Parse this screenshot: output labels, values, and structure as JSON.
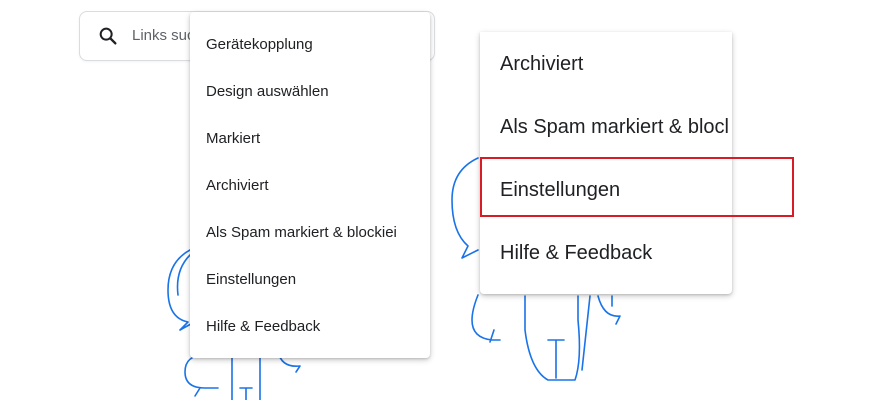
{
  "search": {
    "placeholder_visible": "Links suc"
  },
  "menu_small": {
    "items": [
      {
        "label": "Gerätekopplung"
      },
      {
        "label": "Design auswählen"
      },
      {
        "label": "Markiert"
      },
      {
        "label": "Archiviert"
      },
      {
        "label": "Als Spam markiert & blockiei"
      },
      {
        "label": "Einstellungen"
      },
      {
        "label": "Hilfe & Feedback"
      }
    ]
  },
  "menu_zoom": {
    "items": [
      {
        "label": "Archiviert"
      },
      {
        "label": "Als Spam markiert & blocl"
      },
      {
        "label": "Einstellungen"
      },
      {
        "label": "Hilfe & Feedback"
      }
    ],
    "highlighted": "Einstellungen"
  },
  "colors": {
    "illustration": "#1a73e8",
    "highlight_border": "#d81b25"
  }
}
